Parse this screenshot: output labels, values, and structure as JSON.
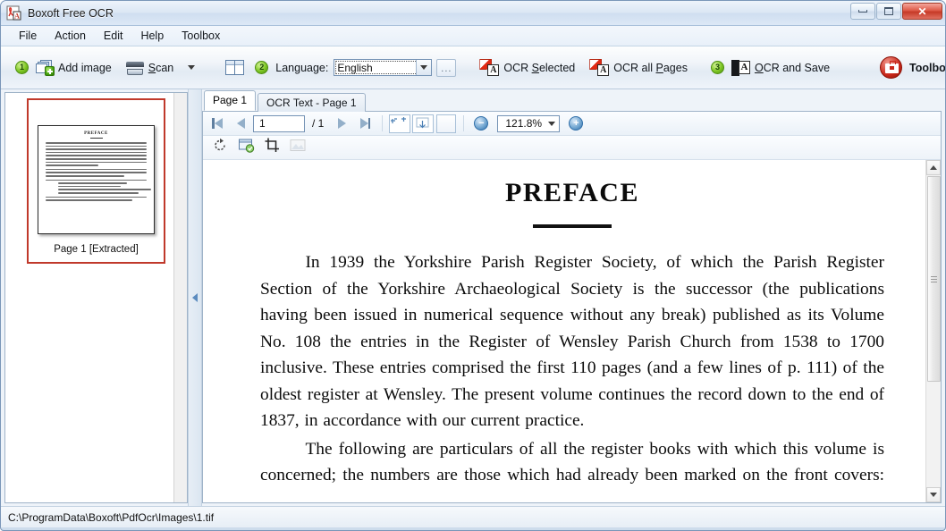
{
  "window": {
    "title": "Boxoft Free OCR",
    "app_icon": "pdf-ocr-icon",
    "ghost_text": "",
    "controls": {
      "minimize": "minimize-icon",
      "maximize": "maximize-icon",
      "close": "✕"
    }
  },
  "menubar": {
    "items": [
      {
        "label": "File"
      },
      {
        "label": "Action"
      },
      {
        "label": "Edit"
      },
      {
        "label": "Help"
      },
      {
        "label": "Toolbox"
      }
    ]
  },
  "toolbar": {
    "step1_badge": "1",
    "add_image": "Add image",
    "scan_pre": "S",
    "scan_rest": "can",
    "scan_label": "Scan",
    "step2_badge": "2",
    "language_label": "Language:",
    "language_value": "English",
    "dots_label": "...",
    "ocr_selected_pre": "OCR ",
    "ocr_selected_u": "S",
    "ocr_selected_post": "elected",
    "ocr_all_pre": "OCR all ",
    "ocr_all_u": "P",
    "ocr_all_post": "ages",
    "step3_badge": "3",
    "ocr_save_u": "O",
    "ocr_save_post": "CR and Save",
    "ocr_letter": "A",
    "toolbox": "Toolbox"
  },
  "thumbnails": {
    "items": [
      {
        "label": "Page 1 [Extracted]",
        "preview_title": "PREFACE",
        "selected": true
      }
    ]
  },
  "splitter": {
    "collapse_icon": "chevron-left-icon"
  },
  "tabs": [
    {
      "label": "Page 1",
      "active": true
    },
    {
      "label": "OCR Text - Page 1",
      "active": false
    }
  ],
  "navbar": {
    "first": "first-page-icon",
    "prev": "prev-page-icon",
    "page_value": "1",
    "page_total": "/ 1",
    "next": "next-page-icon",
    "last": "last-page-icon",
    "fit_page": "fit-page-icon",
    "fit_width": "fit-width-icon",
    "actual_size": "actual-size-icon",
    "zoom_out": "−",
    "zoom_value": "121.8%",
    "zoom_in": "+"
  },
  "editbar": {
    "rotate": "rotate-icon",
    "rescan": "rescan-icon",
    "crop": "crop-icon",
    "image_disabled": "image-icon"
  },
  "document": {
    "title": "PREFACE",
    "paragraphs": [
      "In 1939 the Yorkshire Parish Register Society, of which the Parish Register Section of the Yorkshire Archaeological Society is the successor (the publications having been issued in numerical sequence without any break) published as its Volume No. 108 the entries in the Register of Wensley Parish Church from 1538 to 1700 inclusive.  These entries comprised the first 110 pages (and a few lines of p. 111) of the oldest register at Wensley.   The present volume continues the record down to the end of 1837, in accordance with our current practice.",
      "The following are particulars of all the register books with which this volume is concerned; the numbers are those which had already been marked on the front covers:—"
    ]
  },
  "statusbar": {
    "path": "C:\\ProgramData\\Boxoft\\PdfOcr\\Images\\1.tif"
  },
  "colors": {
    "close_red": "#c63a27",
    "accent_blue": "#2f6ea8",
    "selection_red": "#c0392b",
    "badge_green": "#7cc522",
    "toolbox_red": "#c9271a"
  }
}
